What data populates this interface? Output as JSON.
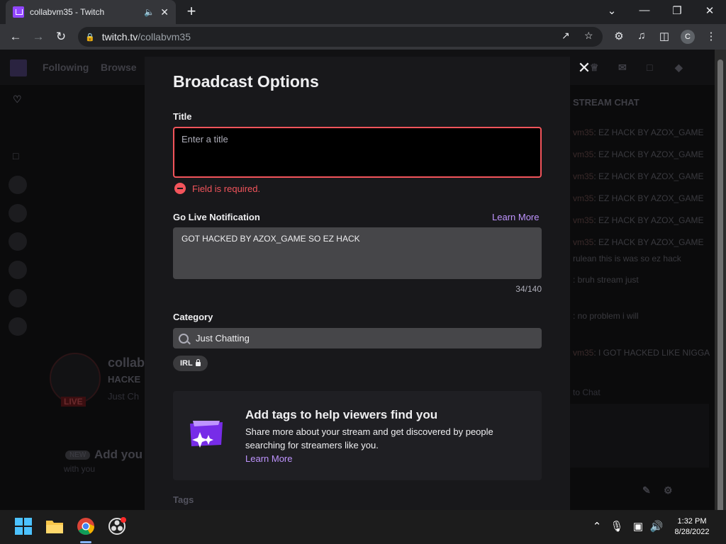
{
  "browser": {
    "tab_title": "collabvm35 - Twitch",
    "url_host": "twitch.tv",
    "url_path": "/collabvm35",
    "profile_initial": "C"
  },
  "background": {
    "nav_following": "Following",
    "nav_browse": "Browse",
    "chat_header": "STREAM CHAT",
    "channel_name": "collab",
    "stream_title": "HACKE",
    "live_badge": "LIVE",
    "category_hint": "Just Ch",
    "new_badge": "NEW",
    "add_text": "Add you",
    "with_you": "with you",
    "send_chat": "to Chat",
    "chat_lines": [
      {
        "name": "vm35",
        "msg": ": EZ HACK BY AZOX_GAME"
      },
      {
        "name": "vm35",
        "msg": ": EZ HACK BY AZOX_GAME"
      },
      {
        "name": "vm35",
        "msg": ": EZ HACK BY AZOX_GAME"
      },
      {
        "name": "vm35",
        "msg": ": EZ HACK BY AZOX_GAME"
      },
      {
        "name": "vm35",
        "msg": ": EZ HACK BY AZOX_GAME"
      },
      {
        "name": "vm35",
        "msg": ": EZ HACK BY AZOX_GAME"
      },
      {
        "name": "",
        "msg": "rulean this is was so ez hack"
      },
      {
        "name": "",
        "msg": ": bruh stream just"
      },
      {
        "name": "",
        "msg": ": no problem i will"
      },
      {
        "name": "vm35",
        "msg": ": I GOT HACKED LIKE NIGGA"
      }
    ]
  },
  "modal": {
    "title": "Broadcast Options",
    "title_field": {
      "label": "Title",
      "placeholder": "Enter a title",
      "value": "",
      "error": "Field is required."
    },
    "notification": {
      "label": "Go Live Notification",
      "learn_more": "Learn More",
      "value": "GOT HACKED BY AZOX_GAME SO EZ HACK",
      "counter": "34/140"
    },
    "category": {
      "label": "Category",
      "value": "Just Chatting",
      "tag": "IRL"
    },
    "promo": {
      "title": "Add tags to help viewers find you",
      "body": "Share more about your stream and get discovered by people searching for streamers like you.",
      "link": "Learn More"
    },
    "tags_label": "Tags"
  },
  "taskbar": {
    "time": "1:32 PM",
    "date": "8/28/2022"
  }
}
